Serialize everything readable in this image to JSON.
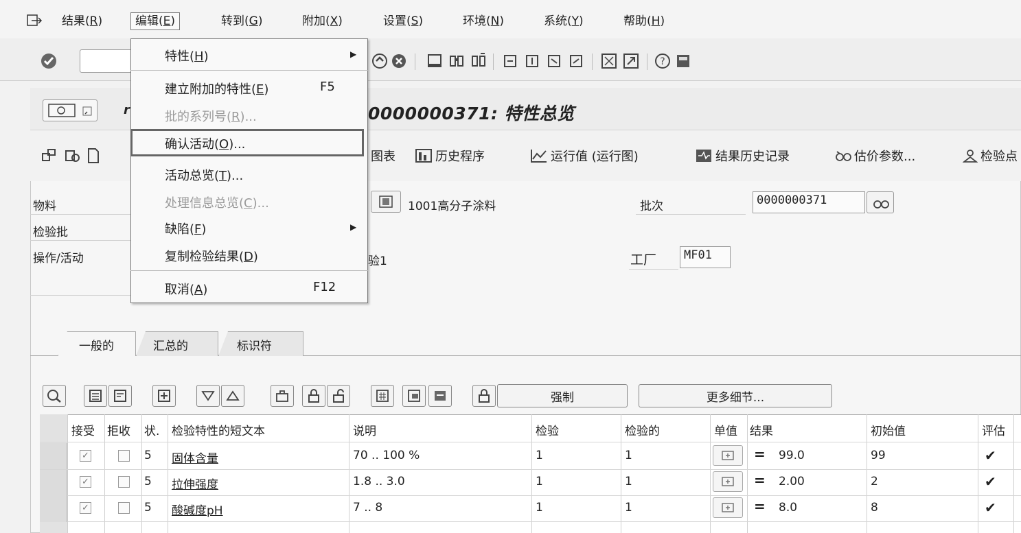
{
  "menubar": {
    "items": [
      {
        "label": "结果(",
        "key": "R",
        "tail": ")"
      },
      {
        "label": "编辑(",
        "key": "E",
        "tail": ")"
      },
      {
        "label": "转到(",
        "key": "G",
        "tail": ")"
      },
      {
        "label": "附加(",
        "key": "X",
        "tail": ")"
      },
      {
        "label": "设置(",
        "key": "S",
        "tail": ")"
      },
      {
        "label": "环境(",
        "key": "N",
        "tail": ")"
      },
      {
        "label": "系统(",
        "key": "Y",
        "tail": ")"
      },
      {
        "label": "帮助(",
        "key": "H",
        "tail": ")"
      }
    ]
  },
  "edit_menu": {
    "items": [
      {
        "label": "特性(",
        "key": "H",
        "tail": ")",
        "submenu": true
      },
      {
        "label": "建立附加的特性(",
        "key": "E",
        "tail": ")",
        "shortcut": "F5"
      },
      {
        "label": "批的系列号(",
        "key": "R",
        "tail": ")...",
        "disabled": true
      },
      {
        "label": "确认活动(",
        "key": "O",
        "tail": ")..."
      },
      {
        "label": "活动总览(",
        "key": "T",
        "tail": ")..."
      },
      {
        "label": "处理信息总览(",
        "key": "C",
        "tail": ")...",
        "disabled": true
      },
      {
        "label": "缺陷(",
        "key": "F",
        "tail": ")",
        "submenu": true
      },
      {
        "label": "复制检验结果(",
        "key": "D",
        "tail": ")"
      },
      {
        "label": "取消(",
        "key": "A",
        "tail": ")",
        "shortcut": "F12"
      }
    ]
  },
  "title": {
    "prefix": "r",
    "text": "0000000371: 特性总览"
  },
  "app_toolbar": {
    "chart": "图表",
    "history": "历史程序",
    "run_chart": "运行值 (运行图)",
    "result_history": "结果历史记录",
    "valuation_params": "估价参数...",
    "inspection_point": "检验点"
  },
  "header": {
    "material_label": "物料",
    "material_desc": "1001高分子涂料",
    "batch_label": "批次",
    "batch_value": "0000000371",
    "lot_label": "检验批",
    "op_label": "操作/活动",
    "op_desc": "验1",
    "plant_label": "工厂",
    "plant_value": "MF01"
  },
  "tabs": [
    "一般的",
    "汇总的",
    "标识符"
  ],
  "grid_toolbar": {
    "force_label": "强制",
    "more_details_label": "更多细节..."
  },
  "table": {
    "columns": [
      "接受",
      "拒收",
      "状.",
      "检验特性的短文本",
      "说明",
      "检验",
      "检验的",
      "单值",
      "结果",
      "初始值",
      "评估"
    ],
    "rows": [
      {
        "accept": true,
        "reject": false,
        "status": "5",
        "text": "固体含量",
        "desc": "70 .. 100 %",
        "insp": "1",
        "inspected": "1",
        "result": "99.0",
        "initial": "99",
        "valuation": "✔"
      },
      {
        "accept": true,
        "reject": false,
        "status": "5",
        "text": "拉伸强度",
        "desc": "1.8 .. 3.0",
        "insp": "1",
        "inspected": "1",
        "result": "2.00",
        "initial": "2",
        "valuation": "✔"
      },
      {
        "accept": true,
        "reject": false,
        "status": "5",
        "text": "酸碱度pH",
        "desc": "7 .. 8",
        "insp": "1",
        "inspected": "1",
        "result": "8.0",
        "initial": "8",
        "valuation": "✔"
      }
    ]
  },
  "colors": {
    "menu_bg": "#f9f9f9",
    "highlight_border": "#666666",
    "disabled_text": "#9a9a9a"
  }
}
